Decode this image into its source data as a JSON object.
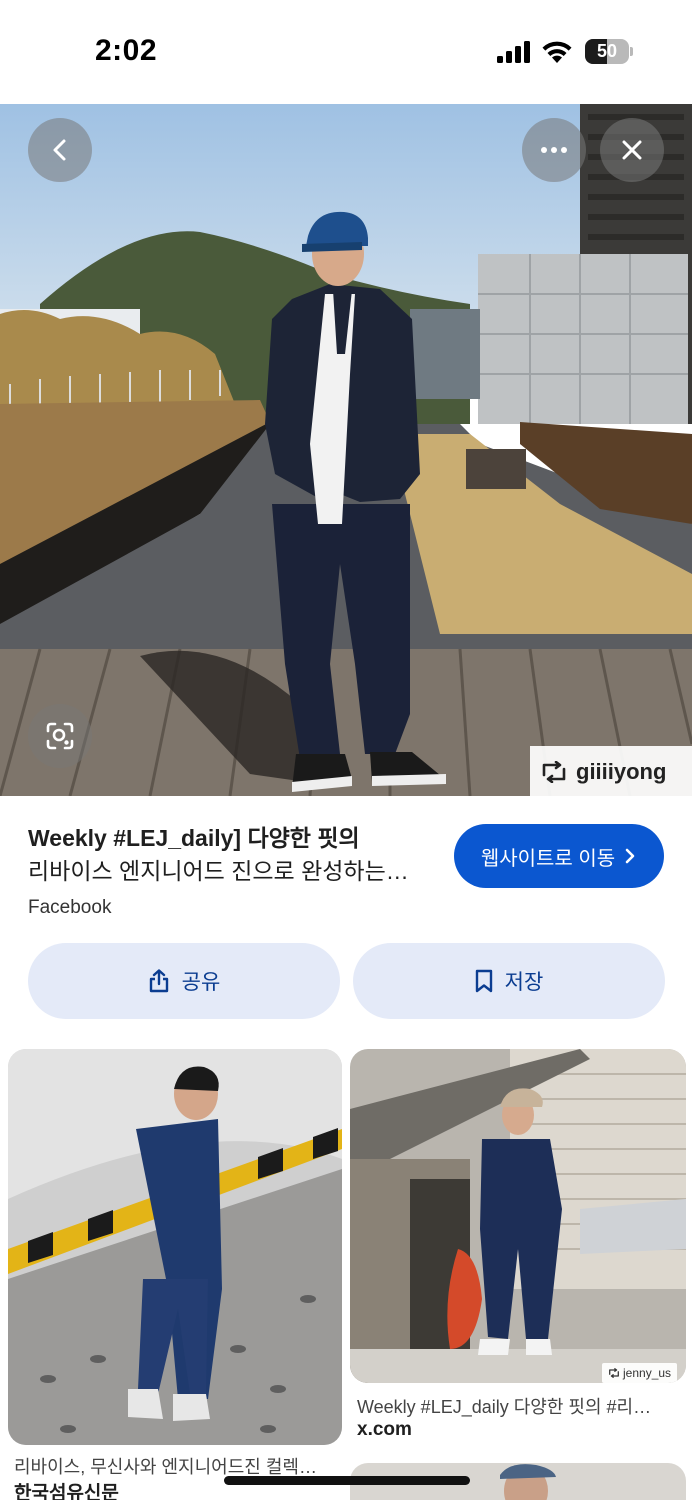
{
  "status_bar": {
    "time": "2:02",
    "battery_level": "50",
    "battery_fraction": 0.5
  },
  "hero": {
    "watermark": "giiiiyong",
    "icons": {
      "back": "chevron-left-icon",
      "more": "more-horizontal-icon",
      "close": "close-icon",
      "lens": "visual-search-icon",
      "repost": "repost-icon"
    }
  },
  "result": {
    "title_line1": "Weekly #LEJ_daily] 다양한 핏의",
    "title_line2": "리바이스 엔지니어드 진으로 완성하는…",
    "source": "Facebook",
    "visit_label": "웹사이트로 이동"
  },
  "actions": {
    "share_label": "공유",
    "save_label": "저장"
  },
  "related": [
    {
      "caption": "리바이스, 무신사와 엔지니어드진 컬렉…",
      "source": "한국섬유신문"
    },
    {
      "caption": "Weekly #LEJ_daily 다양한 핏의 #리…",
      "source": "x.com",
      "watermark": "jenny_us"
    }
  ],
  "colors": {
    "accent": "#0b57d0",
    "tonal_button": "#e4eaf8",
    "tonal_text": "#0b3d91"
  }
}
